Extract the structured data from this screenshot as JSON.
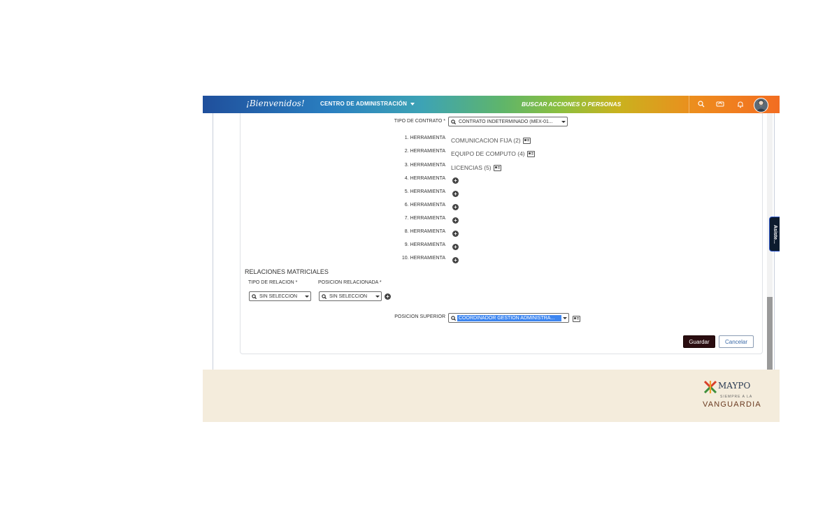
{
  "topbar": {
    "brand": "¡Bienvenidos!",
    "admin_menu_label": "CENTRO DE ADMINISTRACIÓN",
    "search_actions_label": "BUSCAR ACCIONES O PERSONAS",
    "icons": [
      "search-icon",
      "handshake-icon",
      "bell-icon",
      "avatar"
    ]
  },
  "form": {
    "contract_type_label": "TIPO DE CONTRATO *",
    "contract_type_value": "CONTRATO INDETERMINADO (MEX-01...",
    "tools": [
      {
        "label": "1. HERRAMIENTA",
        "value": "COMUNICACION FIJA (2)"
      },
      {
        "label": "2. HERRAMIENTA",
        "value": "EQUIPO DE COMPUTO (4)"
      },
      {
        "label": "3. HERRAMIENTA",
        "value": "LICENCIAS (5)"
      },
      {
        "label": "4. HERRAMIENTA",
        "value": ""
      },
      {
        "label": "5. HERRAMIENTA",
        "value": ""
      },
      {
        "label": "6. HERRAMIENTA",
        "value": ""
      },
      {
        "label": "7. HERRAMIENTA",
        "value": ""
      },
      {
        "label": "8. HERRAMIENTA",
        "value": ""
      },
      {
        "label": "9. HERRAMIENTA",
        "value": ""
      },
      {
        "label": "10. HERRAMIENTA",
        "value": ""
      }
    ],
    "matrix_relations_title": "RELACIONES MATRICIALES",
    "relation_type_label": "TIPO DE RELACION *",
    "relation_type_value": "SIN SELECCIÓN",
    "related_position_label": "POSICION RELACIONADA *",
    "related_position_value": "SIN SELECCIÓN",
    "superior_position_label": "POSICION SUPERIOR",
    "superior_position_value": "COORDINADOR GESTION ADMINISTRA..."
  },
  "buttons": {
    "save": "Guardar",
    "cancel": "Cancelar"
  },
  "assist_tab": "Asiste...",
  "footer": {
    "logo_name": "MAYPO",
    "logo_sub": "SIEMPRE A LA",
    "logo_tagline": "VANGUARDIA"
  },
  "colors": {
    "save_button": "#2a0d10",
    "selected_highlight": "#3e86f0",
    "footer_bg": "#f4ecdc"
  }
}
